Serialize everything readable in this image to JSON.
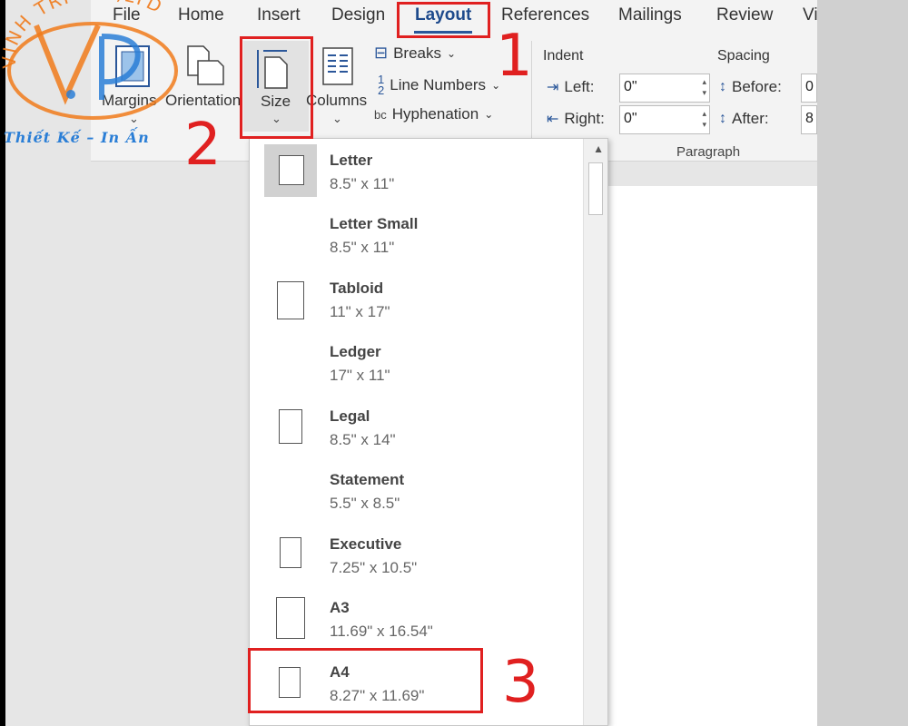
{
  "tabs": [
    {
      "label": "File"
    },
    {
      "label": "Home"
    },
    {
      "label": "Insert"
    },
    {
      "label": "Design"
    },
    {
      "label": "Layout"
    },
    {
      "label": "References"
    },
    {
      "label": "Mailings"
    },
    {
      "label": "Review"
    },
    {
      "label": "Vi"
    }
  ],
  "page_setup": {
    "margins_label": "Margins",
    "orientation_label": "Orientation",
    "size_label": "Size",
    "columns_label": "Columns",
    "breaks_label": "Breaks",
    "line_numbers_label": "Line Numbers",
    "hyphenation_label": "Hyphenation"
  },
  "paragraph": {
    "indent_label": "Indent",
    "spacing_label": "Spacing",
    "left_label": "Left:",
    "right_label": "Right:",
    "left_value": "0\"",
    "right_value": "0\"",
    "before_label": "Before:",
    "after_label": "After:",
    "before_value": "0",
    "after_value": "8",
    "group_label": "Paragraph"
  },
  "size_menu": {
    "items": [
      {
        "name": "Letter",
        "dims": "8.5\" x 11\""
      },
      {
        "name": "Letter Small",
        "dims": "8.5\" x 11\""
      },
      {
        "name": "Tabloid",
        "dims": "11\" x 17\""
      },
      {
        "name": "Ledger",
        "dims": "17\" x 11\""
      },
      {
        "name": "Legal",
        "dims": "8.5\" x 14\""
      },
      {
        "name": "Statement",
        "dims": "5.5\" x 8.5\""
      },
      {
        "name": "Executive",
        "dims": "7.25\" x 10.5\""
      },
      {
        "name": "A3",
        "dims": "11.69\" x 16.54\""
      },
      {
        "name": "A4",
        "dims": "8.27\" x 11.69\""
      }
    ]
  },
  "annotations": {
    "step1": "1",
    "step2": "2",
    "step3": "3"
  },
  "watermark": {
    "company": "VINH TRI CO.,LTD",
    "tagline": "Thiết Kế – In Ấn"
  },
  "colors": {
    "accent": "#2b579a",
    "annotation_red": "#e02020",
    "logo_orange": "#f07a1a",
    "logo_blue": "#2a7ed6"
  }
}
